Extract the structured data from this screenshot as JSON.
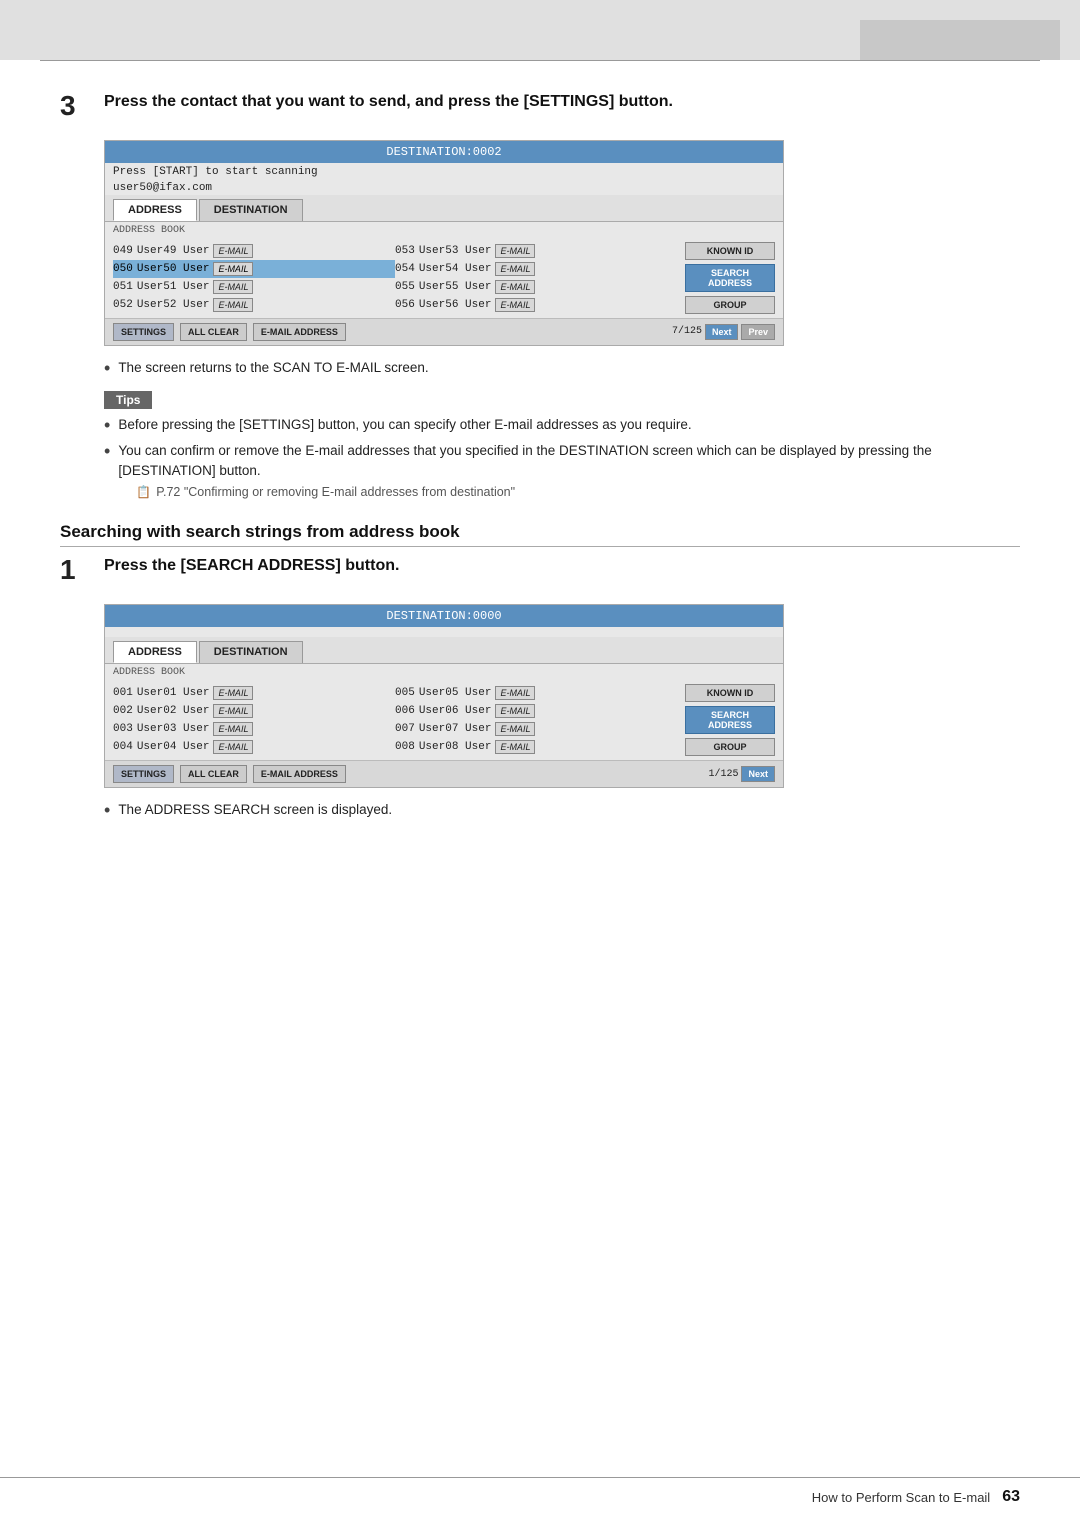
{
  "topbar": {
    "visible": true
  },
  "step3": {
    "number": "3",
    "text": "Press the contact that you want to send, and press the [SETTINGS] button."
  },
  "screen1": {
    "header": "DESTINATION:0002",
    "subtext1": "Press [START] to start scanning",
    "subtext2": "user50@ifax.com",
    "tab_address": "ADDRESS",
    "tab_destination": "DESTINATION",
    "label_addressbook": "ADDRESS BOOK",
    "rows_left": [
      {
        "id": "049",
        "name": "User49 User",
        "badge": "E-MAIL",
        "highlighted": false
      },
      {
        "id": "050",
        "name": "User50 User",
        "badge": "E-MAIL",
        "highlighted": true
      },
      {
        "id": "051",
        "name": "User51 User",
        "badge": "E-MAIL",
        "highlighted": false
      },
      {
        "id": "052",
        "name": "User52 User",
        "badge": "E-MAIL",
        "highlighted": false
      }
    ],
    "rows_right": [
      {
        "id": "053",
        "name": "User53 User",
        "badge": "E-MAIL"
      },
      {
        "id": "054",
        "name": "User54 User",
        "badge": "E-MAIL"
      },
      {
        "id": "055",
        "name": "User55 User",
        "badge": "E-MAIL"
      },
      {
        "id": "056",
        "name": "User56 User",
        "badge": "E-MAIL"
      }
    ],
    "side_buttons": [
      "KNOWN ID",
      "SEARCH ADDRESS",
      "GROUP"
    ],
    "footer_settings": "SETTINGS",
    "footer_allclear": "ALL CLEAR",
    "footer_emailaddress": "E-MAIL ADDRESS",
    "page_info": "7/125",
    "btn_next": "Next",
    "btn_prev": "Prev"
  },
  "bullet1": {
    "text": "The screen returns to the SCAN TO E-MAIL screen."
  },
  "tips": {
    "label": "Tips",
    "item1": "Before pressing the [SETTINGS] button, you can specify other E-mail addresses as you require.",
    "item2": "You can confirm or remove the E-mail addresses that you specified in the DESTINATION screen which can be displayed by pressing the [DESTINATION] button.",
    "item2_sub": "P.72 \"Confirming or removing E-mail addresses from destination\""
  },
  "section": {
    "heading": "Searching with search strings from address book"
  },
  "step1": {
    "number": "1",
    "text": "Press the [SEARCH ADDRESS] button."
  },
  "screen2": {
    "header": "DESTINATION:0000",
    "tab_address": "ADDRESS",
    "tab_destination": "DESTINATION",
    "label_addressbook": "ADDRESS BOOK",
    "rows_left": [
      {
        "id": "001",
        "name": "User01 User",
        "badge": "E-MAIL"
      },
      {
        "id": "002",
        "name": "User02 User",
        "badge": "E-MAIL"
      },
      {
        "id": "003",
        "name": "User03 User",
        "badge": "E-MAIL"
      },
      {
        "id": "004",
        "name": "User04 User",
        "badge": "E-MAIL"
      }
    ],
    "rows_right": [
      {
        "id": "005",
        "name": "User05 User",
        "badge": "E-MAIL"
      },
      {
        "id": "006",
        "name": "User06 User",
        "badge": "E-MAIL"
      },
      {
        "id": "007",
        "name": "User07 User",
        "badge": "E-MAIL"
      },
      {
        "id": "008",
        "name": "User08 User",
        "badge": "E-MAIL"
      }
    ],
    "side_buttons": [
      "KNOWN ID",
      "SEARCH ADDRESS",
      "GROUP"
    ],
    "side_active": "SEARCH ADDRESS",
    "footer_settings": "SETTINGS",
    "footer_allclear": "ALL CLEAR",
    "footer_emailaddress": "E-MAIL ADDRESS",
    "page_info": "1/125",
    "btn_next": "Next"
  },
  "bullet2": {
    "text": "The ADDRESS SEARCH screen is displayed."
  },
  "footer": {
    "text": "How to Perform Scan to E-mail",
    "page": "63"
  }
}
